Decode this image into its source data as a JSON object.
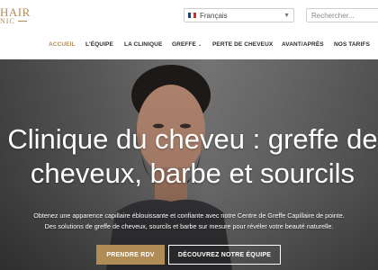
{
  "logo": {
    "line1": "HAIR",
    "line2": "NIC"
  },
  "language": {
    "selected": "Français",
    "flag_colors": [
      "#1f3c9a",
      "#ffffff",
      "#d62b2b"
    ]
  },
  "search": {
    "placeholder": "Rechercher..."
  },
  "nav": {
    "items": [
      {
        "label": "ACCUEIL",
        "active": true
      },
      {
        "label": "L'ÉQUIPE"
      },
      {
        "label": "LA CLINIQUE"
      },
      {
        "label": "GREFFE"
      },
      {
        "label": "PERTE DE CHEVEUX"
      },
      {
        "label": "AVANT/APRÈS"
      },
      {
        "label": "NOS TARIFS"
      }
    ]
  },
  "hero": {
    "title_line1": "Clinique du cheveu : greffe de",
    "title_line2": "cheveux, barbe et sourcils",
    "subtitle_line1": "Obtenez une apparence capillaire éblouissante et confiante avec notre Centre de Greffe Capillaire de pointe.",
    "subtitle_line2": "Des solutions de greffe de cheveux, sourcils et barbe sur mesure pour révéler votre beauté naturelle.",
    "primary_button": "PRENDRE RDV",
    "secondary_button": "DÉCOUVREZ NOTRE ÉQUIPE"
  },
  "colors": {
    "accent": "#b08d57",
    "nav_text": "#2b2b2b",
    "hero_text": "#ffffff"
  }
}
